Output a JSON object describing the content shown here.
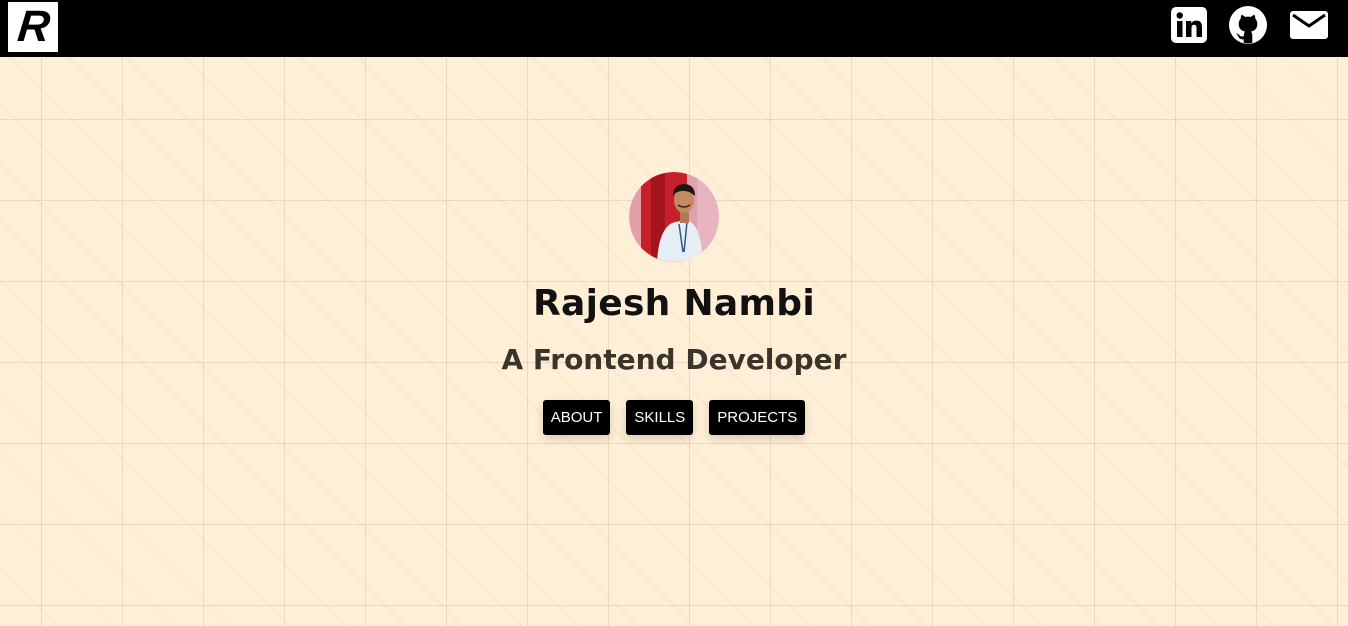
{
  "header": {
    "logo_letter": "R",
    "social": [
      {
        "name": "linkedin",
        "icon": "linkedin-icon"
      },
      {
        "name": "github",
        "icon": "github-icon"
      },
      {
        "name": "email",
        "icon": "mail-icon"
      }
    ]
  },
  "hero": {
    "avatar_icon": "profile-photo",
    "name": "Rajesh Nambi",
    "role": "A Frontend Developer",
    "nav": {
      "about": "ABOUT",
      "skills": "SKILLS",
      "projects": "PROJECTS"
    }
  },
  "colors": {
    "background": "#ffefd6",
    "header": "#000000",
    "button": "#000000",
    "button_text": "#ffffff"
  }
}
